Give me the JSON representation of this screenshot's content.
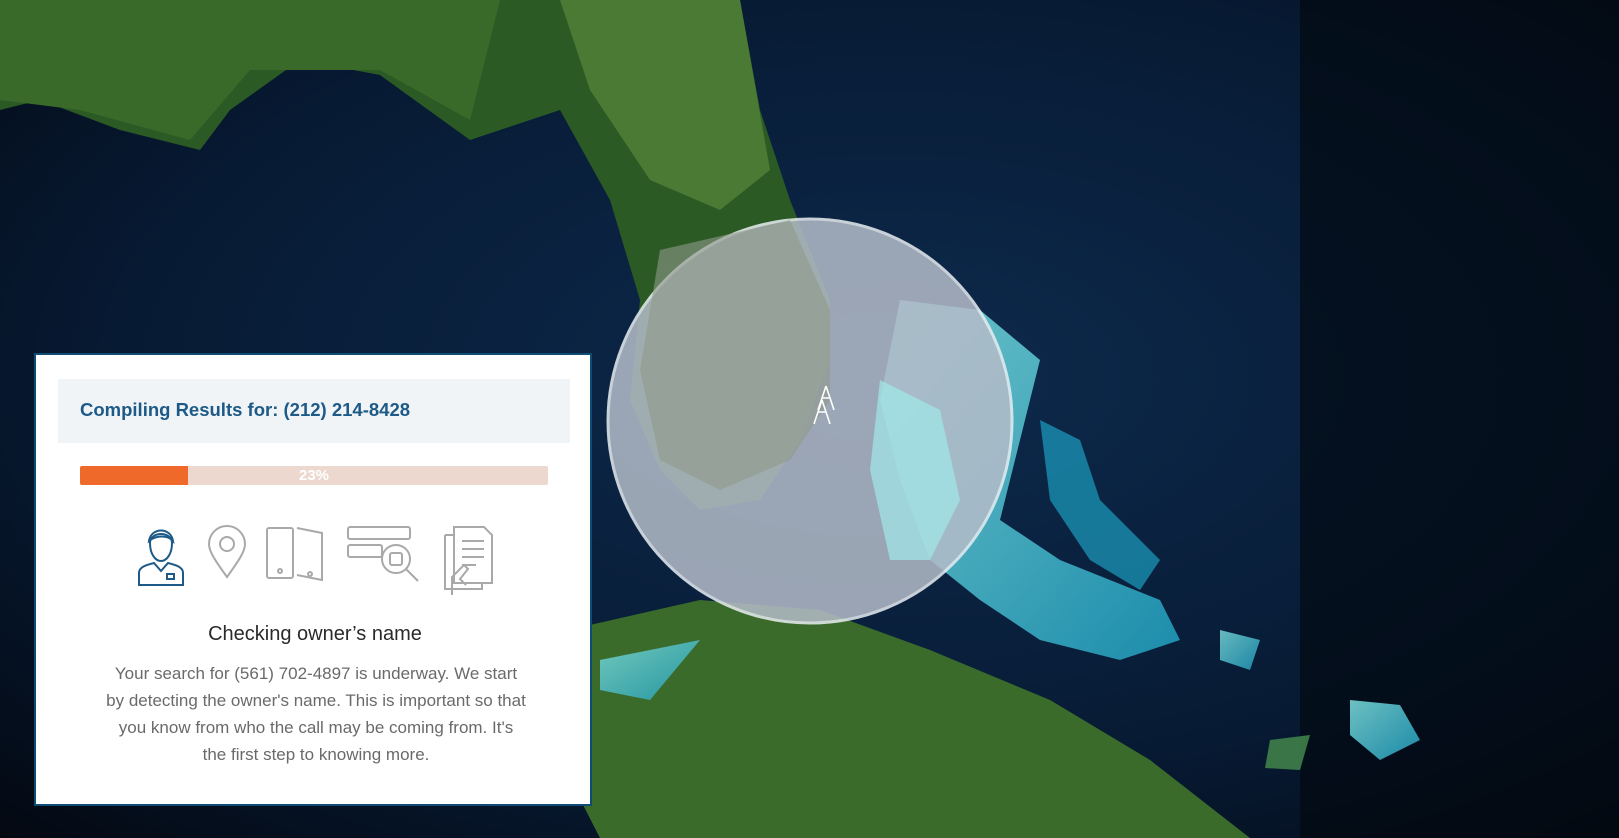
{
  "search": {
    "title_prefix": "Compiling Results for:",
    "title_number": "(212) 214-8428",
    "progress_value": 0.23,
    "progress_label": "23%"
  },
  "steps": {
    "icons": [
      "person-icon",
      "location-pin-icon",
      "phones-icon",
      "records-search-icon",
      "documents-icon"
    ],
    "active_index": 0
  },
  "current_step": {
    "title": "Checking owner’s name",
    "description": "Your search for (561) 702-4897 is underway. We start by detecting the owner's name. This is important so that you know from who the call may be coming from. It's the first step to knowing more."
  },
  "colors": {
    "accent": "#ef6a2a",
    "progress_track": "#ecd8cf",
    "title": "#1d5a87",
    "active_icon": "#1d5a87",
    "inactive_icon": "#a9a9a9"
  }
}
